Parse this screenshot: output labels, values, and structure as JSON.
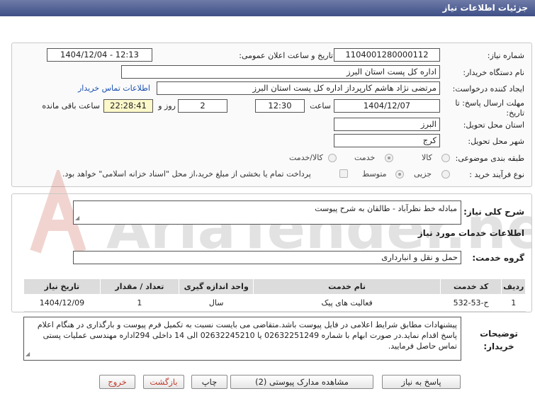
{
  "window": {
    "title": "جزئیات اطلاعات نیاز"
  },
  "form": {
    "need_number_label": "شماره نیاز:",
    "need_number": "1104001280000112",
    "announce_label": "تاریخ و ساعت اعلان عمومی:",
    "announce_value": "1404/12/04 - 12:13",
    "buyer_org_label": "نام دستگاه خریدار:",
    "buyer_org": "اداره کل پست استان البرز",
    "creator_label": "ایجاد کننده درخواست:",
    "creator": "مرتضی  نژاد هاشم کارپرداز اداره کل پست استان البرز",
    "contact_link": "اطلاعات تماس خریدار",
    "deadline_label": "مهلت ارسال پاسخ: تا تاریخ:",
    "deadline_date": "1404/12/07",
    "hour_label": "ساعت",
    "deadline_time": "12:30",
    "days_value": "2",
    "days_label": "روز و",
    "remaining_time": "22:28:41",
    "remaining_label": "ساعت باقی مانده",
    "province_label": "استان محل تحویل:",
    "province": "البرز",
    "city_label": "شهر محل تحویل:",
    "city": "کرج",
    "category_label": "طبقه بندی موضوعی:",
    "category_options": [
      "کالا",
      "خدمت",
      "کالا/خدمت"
    ],
    "category_selected": "خدمت",
    "process_label": "نوع فرآیند خرید :",
    "process_options": [
      "جزیی",
      "متوسط"
    ],
    "process_selected": "متوسط",
    "payment_note": "پرداخت تمام یا بخشی از مبلغ خرید،از محل \"اسناد خزانه اسلامی\" خواهد بود."
  },
  "summary": {
    "label": "شرح کلی نیاز:",
    "value": "مبادله خط نظرآباد - طالقان به شرح پیوست"
  },
  "services": {
    "section_title": "اطلاعات خدمات مورد نیاز",
    "group_label": "گروه خدمت:",
    "group_value": "حمل و نقل و انبارداری",
    "columns": [
      "ردیف",
      "کد خدمت",
      "نام خدمت",
      "واحد اندازه گیری",
      "تعداد / مقدار",
      "تاریخ نیاز"
    ],
    "rows": [
      {
        "row": "1",
        "code": "ح-53-532",
        "name": "فعالیت های پیک",
        "unit": "سال",
        "qty": "1",
        "date": "1404/12/09"
      }
    ]
  },
  "buyer_notes": {
    "label": "توضیحات خریدار:",
    "text": "پیشنهادات مطابق شرایط اعلامی در فایل پیوست باشد.متقاضی می بایست نسبت به تکمیل فرم پیوست و بارگذاری در هنگام اعلام پاسخ اقدام نماید.در صورت ابهام با شماره 02632251249 یا 02632245210 الی 14 داخلی 294اداره مهندسی عملیات پستی تماس حاصل فرمایید."
  },
  "watermark": {
    "text": "AriaTender.net"
  },
  "buttons": {
    "reply": "پاسخ به نیاز",
    "docs": "مشاهده مدارک پیوستی (2)",
    "print": "چاپ",
    "back": "بازگشت",
    "exit": "خروج"
  },
  "colors": {
    "titlebar": "#3f4f86",
    "link": "#1a4fb0",
    "time_bg": "#fdf8c9",
    "exit_text": "#c0392b"
  }
}
